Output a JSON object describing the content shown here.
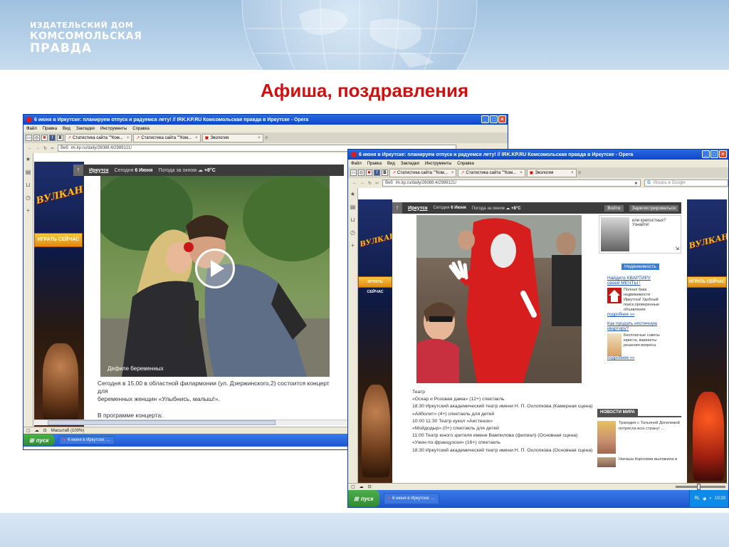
{
  "header": {
    "logo_line1": "ИЗДАТЕЛЬСКИЙ ДОМ",
    "logo_line2": "КОМСОМОЛЬСКАЯ",
    "logo_line3": "ПРАВДА"
  },
  "slide_title": "Афиша, поздравления",
  "left_window": {
    "title": "6 июня в Иркутске: планируем отпуск и радуемся лету! // IRK.KP.RU Комсомольская правда в Иркутске - Opera",
    "menu": [
      "Файл",
      "Правка",
      "Вид",
      "Закладки",
      "Инструменты",
      "Справка"
    ],
    "tabs": [
      "Статистика сайта \"\"Ком...",
      "Статистика сайта \"\"Ком...",
      "Экология"
    ],
    "address_label": "Веб",
    "address": "irk.kp.ru/daily/26088.4/2989121/",
    "site": {
      "city": "Иркутск",
      "today_label": "Сегодня",
      "today_value": "6 Июня",
      "weather_label": "Погода за окном",
      "weather_value": "+8°C"
    },
    "ad": {
      "brand": "ВУЛКАН",
      "cta": "ИГРАТЬ СЕЙЧАС"
    },
    "video_caption": "Дефиле беременных",
    "article_line1": "Сегодня в 15.00 в областной филармонии (ул. Дзержинского,2) состоится концерт для",
    "article_line2": "беременных женщин «Улыбнись, малыш!».",
    "article_line3": "В программе концерта:",
    "status_scale": "Масштаб (100%)",
    "start": "пуск",
    "task": "6 июня в Иркутске: ..."
  },
  "right_window": {
    "title": "6 июня в Иркутске: планируем отпуск и радуемся лету! // IRK.KP.RU Комсомольская правда в Иркутске - Opera",
    "menu": [
      "Файл",
      "Правка",
      "Вид",
      "Закладки",
      "Инструменты",
      "Справка"
    ],
    "tabs": [
      "Статистика сайта \"\"Ком...",
      "Статистика сайта \"\"Ком...",
      "Экология"
    ],
    "address_label": "Веб",
    "address": "irk.kp.ru/daily/26088.4/2989121/",
    "search_placeholder": "Искать в Google",
    "site": {
      "city": "Иркутск",
      "today_label": "Сегодня",
      "today_value": "6 Июня",
      "weather_label": "Погода за окном",
      "weather_value": "+8°C",
      "login": "Войти",
      "register": "Зарегистрироваться"
    },
    "ad": {
      "brand": "ВУЛКАН",
      "cta": "ИГРАТЬ СЕЙЧАС"
    },
    "teaser": "или крепостных? Узнайте!",
    "realty_header": "Недвижимость",
    "realty_link1": "Найдите КВАРТИРУ своей МЕЧТЫ !",
    "realty_text1": "Полная база недвижимости Иркутска! Удобный поиск,проверенные объявления",
    "realty_more1": "подробнее »»",
    "realty_link2": "Как продать ипотечную квартиру?",
    "realty_text2": "Бесплатные советы юриста, варианты решения вопроса",
    "realty_more2": "подробнее »»",
    "world_news_header": "НОВОСТИ МИРА",
    "news1": "Трагедия с Татьяной Догилевой потрясла всю страну! ...",
    "news2": "Наташа Королева выложила в",
    "theatre": [
      "Театр",
      "«Оскар и Розовая дама» (12+) спектакль",
      "18:30 Иркутский академический театр имени Н. П. Охлопкова (Камерная сцена)",
      "«Айболит» (4+) спектакль для детей",
      "10:00 11:30 Театр кукол «Аистенок»",
      "«Мойдодыр» (0+) спектакль для детей",
      "11:00 Театр юного зрителя имени Вампилова (филиал) (Основная сцена)",
      "«Ужин по-французски» (16+) спектакль",
      "18:30 Иркутский академический театр имени Н. П. Охлопкова (Основная сцена)"
    ],
    "start": "пуск",
    "task": "6 июня в Иркутске: ...",
    "tray_lang": "RL",
    "tray_time": "10:33"
  }
}
